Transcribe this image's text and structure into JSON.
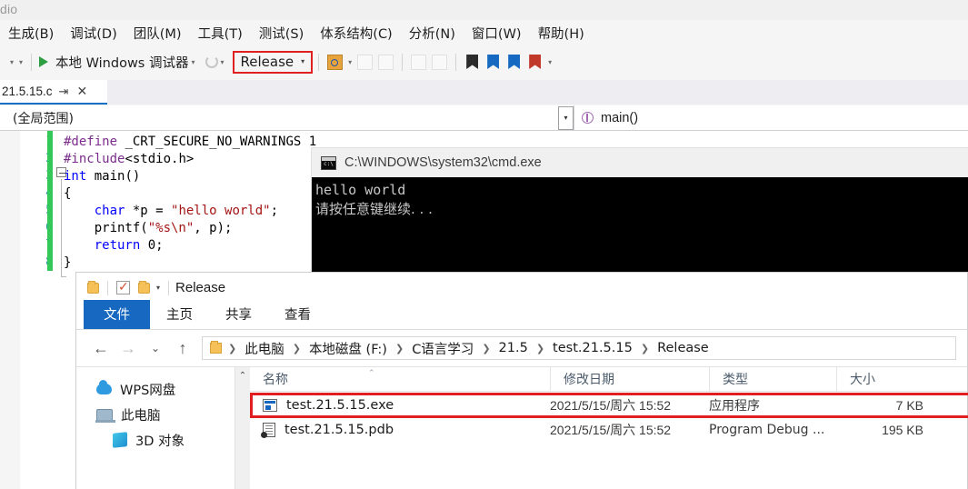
{
  "vs": {
    "title_fragment": "dio",
    "menu": [
      {
        "label": "生成(B)",
        "name": "menu-build"
      },
      {
        "label": "调试(D)",
        "name": "menu-debug"
      },
      {
        "label": "团队(M)",
        "name": "menu-team"
      },
      {
        "label": "工具(T)",
        "name": "menu-tools"
      },
      {
        "label": "测试(S)",
        "name": "menu-test"
      },
      {
        "label": "体系结构(C)",
        "name": "menu-architecture"
      },
      {
        "label": "分析(N)",
        "name": "menu-analyze"
      },
      {
        "label": "窗口(W)",
        "name": "menu-window"
      },
      {
        "label": "帮助(H)",
        "name": "menu-help"
      }
    ],
    "toolbar": {
      "start_debug_label": "本地 Windows 调试器",
      "configuration": "Release",
      "configuration_highlight_color": "#e02020"
    },
    "tab": {
      "label": "21.5.15.c",
      "pin_glyph": "⇥",
      "close_glyph": "✕"
    },
    "navbar": {
      "scope": "(全局范围)",
      "member": "main()"
    },
    "editor": {
      "line_numbers": [
        "1",
        "2",
        "3",
        "4",
        "5",
        "6",
        "7",
        "8"
      ],
      "lines": [
        "#define _CRT_SECURE_NO_WARNINGS 1",
        "#include<stdio.h>",
        "int main()",
        "{",
        "    char *p = \"hello world\";",
        "    printf(\"%s\\n\", p);",
        "    return 0;",
        "}"
      ]
    }
  },
  "cmd": {
    "title": "C:\\WINDOWS\\system32\\cmd.exe",
    "output": [
      "hello world",
      "请按任意键继续. . ."
    ]
  },
  "explorer": {
    "window_title": "Release",
    "ribbon_tabs": [
      {
        "label": "文件",
        "name": "ribbon-tab-file",
        "active": true
      },
      {
        "label": "主页",
        "name": "ribbon-tab-home",
        "active": false
      },
      {
        "label": "共享",
        "name": "ribbon-tab-share",
        "active": false
      },
      {
        "label": "查看",
        "name": "ribbon-tab-view",
        "active": false
      }
    ],
    "breadcrumb": [
      "此电脑",
      "本地磁盘 (F:)",
      "C语言学习",
      "21.5",
      "test.21.5.15",
      "Release"
    ],
    "nav_pane": [
      {
        "label": "WPS网盘",
        "icon": "cloud-icon",
        "name": "nav-item-wps"
      },
      {
        "label": "此电脑",
        "icon": "pc-icon",
        "name": "nav-item-this-pc"
      },
      {
        "label": "3D 对象",
        "icon": "cube-icon",
        "name": "nav-item-3d-objects"
      }
    ],
    "columns": [
      "名称",
      "修改日期",
      "类型",
      "大小"
    ],
    "files": [
      {
        "name": "test.21.5.15.exe",
        "date": "2021/5/15/周六 15:52",
        "type": "应用程序",
        "size": "7 KB",
        "icon": "exe-icon",
        "highlighted": true
      },
      {
        "name": "test.21.5.15.pdb",
        "date": "2021/5/15/周六 15:52",
        "type": "Program Debug ...",
        "size": "195 KB",
        "icon": "pdb-icon",
        "highlighted": false
      }
    ],
    "highlight_color": "#e02020"
  }
}
